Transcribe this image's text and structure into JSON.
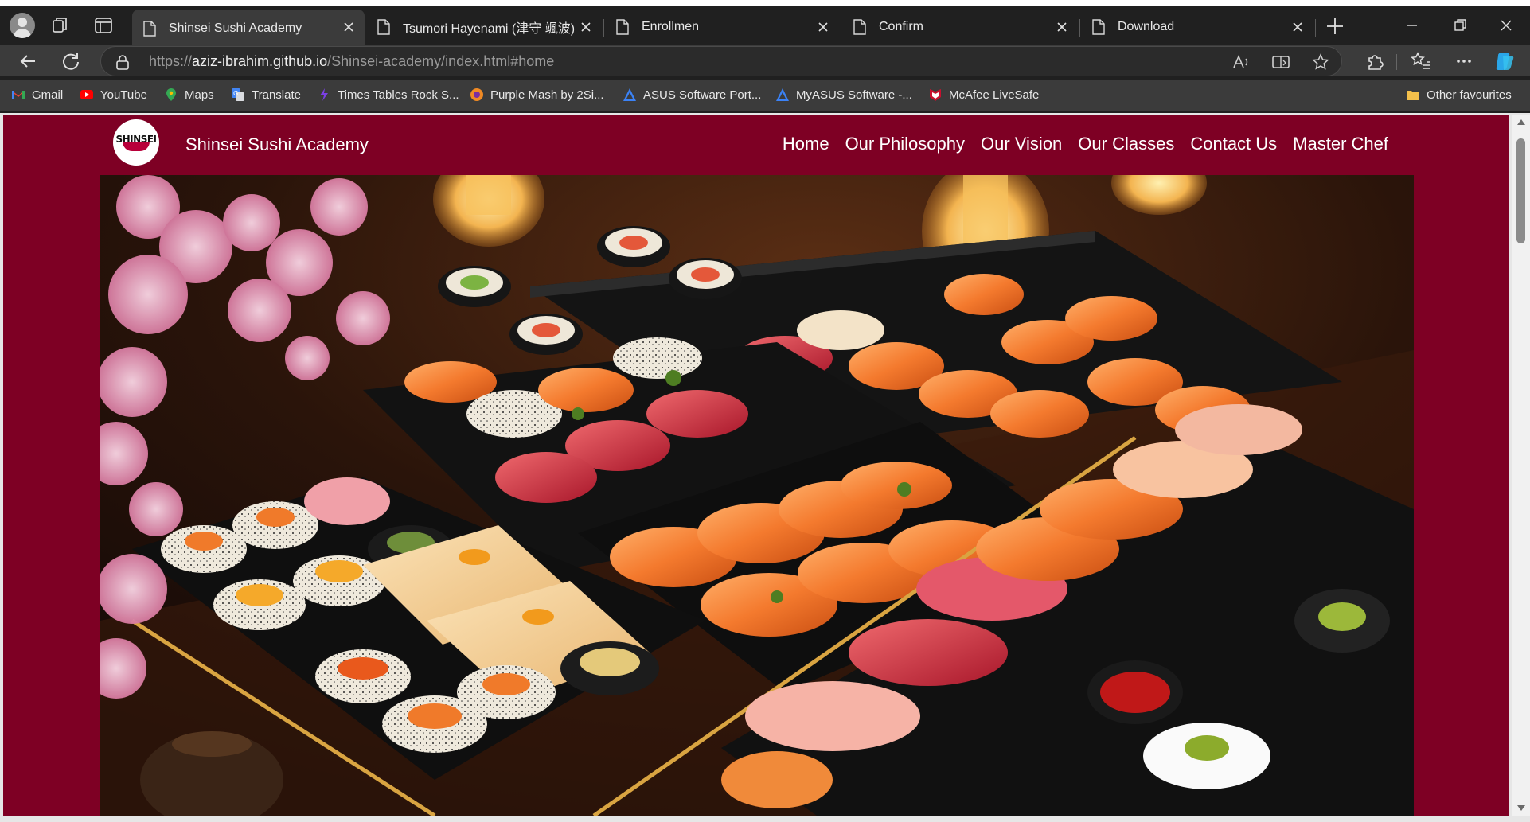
{
  "browser": {
    "tabs": [
      {
        "title": "Shinsei Sushi Academy",
        "active": true
      },
      {
        "title": "Tsumori Hayenami (津守 颯波)",
        "active": false
      },
      {
        "title": "Enrollmen",
        "active": false
      },
      {
        "title": "Confirm",
        "active": false
      },
      {
        "title": "Download",
        "active": false
      }
    ],
    "url": {
      "scheme": "https://",
      "host": "aziz-ibrahim.github.io",
      "path": "/Shinsei-academy/index.html#home"
    },
    "bookmarks": [
      {
        "label": "Gmail",
        "icon": "gmail-icon",
        "color": "#ea4335"
      },
      {
        "label": "YouTube",
        "icon": "youtube-icon",
        "color": "#ff0000"
      },
      {
        "label": "Maps",
        "icon": "maps-icon",
        "color": "#34a853"
      },
      {
        "label": "Translate",
        "icon": "translate-icon",
        "color": "#4285f4"
      },
      {
        "label": "Times Tables Rock S...",
        "icon": "ttrs-icon",
        "color": "#7b3fe4"
      },
      {
        "label": "Purple Mash by 2Si...",
        "icon": "purple-mash-icon",
        "color": "#f08a24"
      },
      {
        "label": "ASUS Software Port...",
        "icon": "asus-icon",
        "color": "#3b82f6"
      },
      {
        "label": "MyASUS Software -...",
        "icon": "asus-icon",
        "color": "#3b82f6"
      },
      {
        "label": "McAfee LiveSafe",
        "icon": "mcafee-icon",
        "color": "#c8102e"
      }
    ],
    "other_favourites": "Other favourites"
  },
  "site": {
    "brand": "Shinsei Sushi Academy",
    "logo_text": "SHINSEI",
    "nav": [
      "Home",
      "Our Philosophy",
      "Our Vision",
      "Our Classes",
      "Contact Us",
      "Master Chef"
    ],
    "hero_image": "sushi-platter-image",
    "colors": {
      "brand_bg": "#7e0024",
      "nav_text": "#ffffff"
    }
  }
}
